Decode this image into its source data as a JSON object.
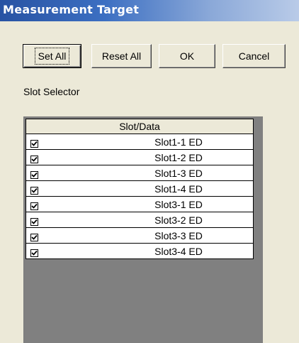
{
  "window": {
    "title": "Measurement Target"
  },
  "toolbar": {
    "set_all_label": "Set All",
    "reset_all_label": "Reset All",
    "ok_label": "OK",
    "cancel_label": "Cancel"
  },
  "slot_selector": {
    "label": "Slot Selector",
    "column_header": "Slot/Data",
    "rows": [
      {
        "label": "Slot1-1 ED",
        "checked": true
      },
      {
        "label": "Slot1-2 ED",
        "checked": true
      },
      {
        "label": "Slot1-3 ED",
        "checked": true
      },
      {
        "label": "Slot1-4 ED",
        "checked": true
      },
      {
        "label": "Slot3-1 ED",
        "checked": true
      },
      {
        "label": "Slot3-2 ED",
        "checked": true
      },
      {
        "label": "Slot3-3 ED",
        "checked": true
      },
      {
        "label": "Slot3-4 ED",
        "checked": true
      }
    ]
  },
  "colors": {
    "title_bar_start": "#2853a3",
    "title_bar_end": "#b9cbe8",
    "dialog_background": "#ece9d8",
    "grid_background": "#808080"
  }
}
